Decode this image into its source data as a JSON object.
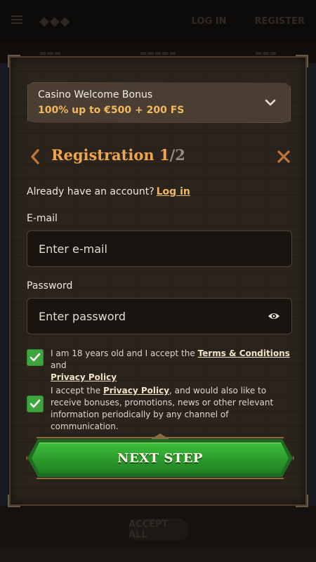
{
  "background": {
    "login_label": "LOG IN",
    "register_label": "REGISTER",
    "accept_all_label": "ACCEPT ALL"
  },
  "bonus": {
    "title": "Casino Welcome Bonus",
    "value": "100% up to €500 + 200 FS",
    "icon": "chevron-down-icon"
  },
  "header": {
    "title": "Registration",
    "step_current": "1",
    "step_separator": "/",
    "step_total": "2",
    "back_icon": "chevron-left-icon",
    "close_icon": "close-icon"
  },
  "account": {
    "prompt": "Already have an account?",
    "login_link": "Log in"
  },
  "email": {
    "label": "E-mail",
    "placeholder": "Enter e-mail",
    "value": ""
  },
  "password": {
    "label": "Password",
    "placeholder": "Enter password",
    "value": "",
    "icon": "eye-icon"
  },
  "consent1": {
    "checked": true,
    "text_before": "I am 18 years old and I accept the",
    "terms_link": "Terms & Conditions",
    "and": "and",
    "privacy_link": "Privacy Policy"
  },
  "consent2": {
    "checked": true,
    "text_before": "I accept the",
    "privacy_link": "Privacy Policy",
    "text_after": ", and would also like to receive bonuses, promotions, news or other relevant information periodically by any channel of communication."
  },
  "next_button": {
    "label": "NEXT STEP"
  },
  "colors": {
    "accent": "#f0b861",
    "title": "#f0a54a",
    "checkbox": "#3ea53e",
    "button": "#2c9a2c",
    "panel": "#2b241d"
  }
}
